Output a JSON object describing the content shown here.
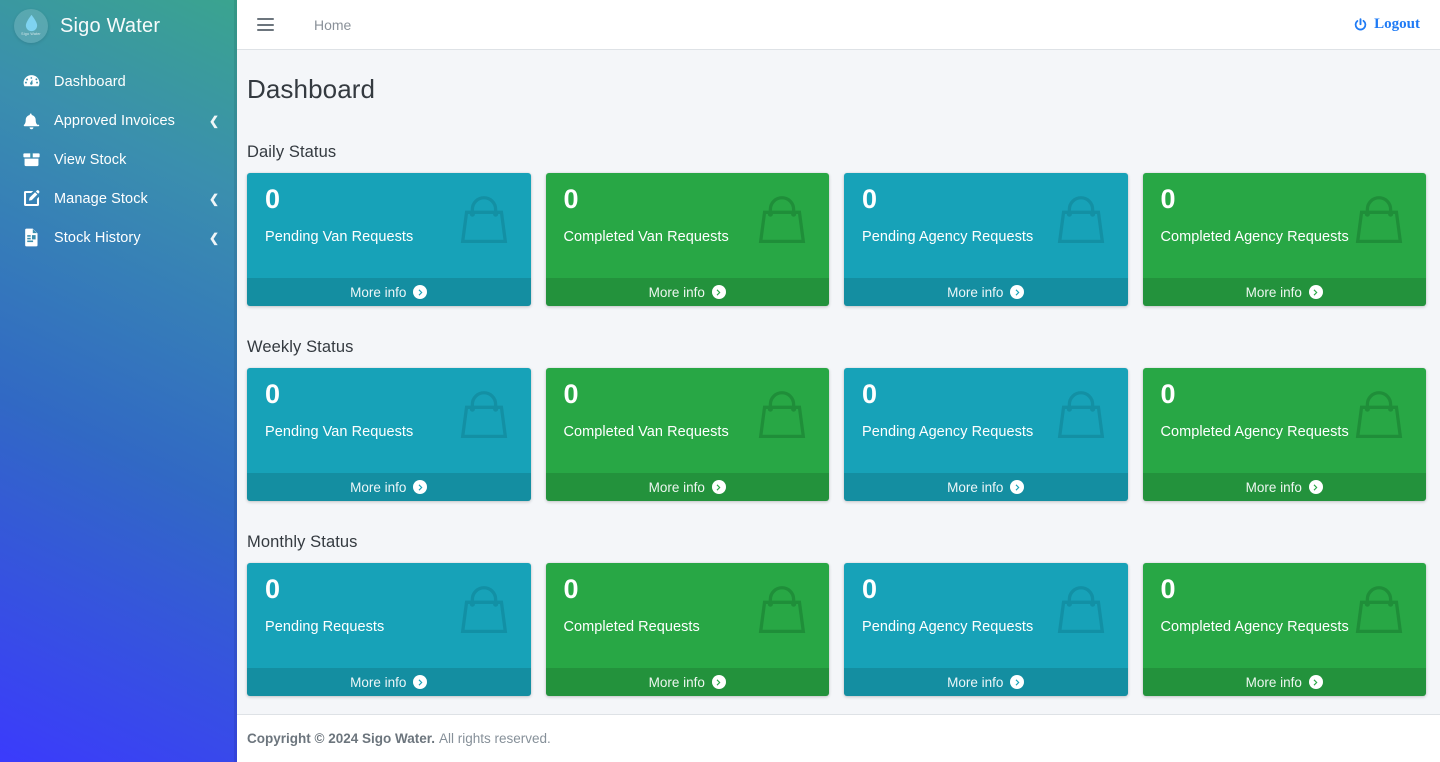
{
  "sidebar": {
    "brand": {
      "title": "Sigo Water",
      "logo_icon": "water-drop-icon",
      "logo_caption": "Sigo Water"
    },
    "items": [
      {
        "label": "Dashboard",
        "icon": "tachometer-icon",
        "chevron": ""
      },
      {
        "label": "Approved Invoices",
        "icon": "bell-icon",
        "chevron": "❮"
      },
      {
        "label": "View Stock",
        "icon": "box-icon",
        "chevron": ""
      },
      {
        "label": "Manage Stock",
        "icon": "edit-square-icon",
        "chevron": "❮"
      },
      {
        "label": "Stock History",
        "icon": "file-text-icon",
        "chevron": "❮"
      }
    ],
    "gradient_from": "#3aa48f",
    "gradient_to": "#3b3bfc"
  },
  "navbar": {
    "menu_toggle_icon": "hamburger-icon",
    "home_label": "Home",
    "logout_label": "Logout",
    "logout_icon": "power-icon",
    "logout_color": "#1f7bf5"
  },
  "page": {
    "title": "Dashboard"
  },
  "colors": {
    "teal": "#17a2b8",
    "green": "#28a745",
    "content_bg": "#f4f6f9"
  },
  "sections": [
    {
      "title": "Daily Status",
      "cards": [
        {
          "value": "0",
          "label": "Pending Van Requests",
          "color": "teal",
          "more_info": "More info",
          "icon": "shopping-bag-icon"
        },
        {
          "value": "0",
          "label": "Completed Van Requests",
          "color": "green",
          "more_info": "More info",
          "icon": "shopping-bag-icon"
        },
        {
          "value": "0",
          "label": "Pending Agency Requests",
          "color": "teal",
          "more_info": "More info",
          "icon": "shopping-bag-icon"
        },
        {
          "value": "0",
          "label": "Completed Agency Requests",
          "color": "green",
          "more_info": "More info",
          "icon": "shopping-bag-icon"
        }
      ]
    },
    {
      "title": "Weekly Status",
      "cards": [
        {
          "value": "0",
          "label": "Pending Van Requests",
          "color": "teal",
          "more_info": "More info",
          "icon": "shopping-bag-icon"
        },
        {
          "value": "0",
          "label": "Completed Van Requests",
          "color": "green",
          "more_info": "More info",
          "icon": "shopping-bag-icon"
        },
        {
          "value": "0",
          "label": "Pending Agency Requests",
          "color": "teal",
          "more_info": "More info",
          "icon": "shopping-bag-icon"
        },
        {
          "value": "0",
          "label": "Completed Agency Requests",
          "color": "green",
          "more_info": "More info",
          "icon": "shopping-bag-icon"
        }
      ]
    },
    {
      "title": "Monthly Status",
      "cards": [
        {
          "value": "0",
          "label": "Pending Requests",
          "color": "teal",
          "more_info": "More info",
          "icon": "shopping-bag-icon"
        },
        {
          "value": "0",
          "label": "Completed Requests",
          "color": "green",
          "more_info": "More info",
          "icon": "shopping-bag-icon"
        },
        {
          "value": "0",
          "label": "Pending Agency Requests",
          "color": "teal",
          "more_info": "More info",
          "icon": "shopping-bag-icon"
        },
        {
          "value": "0",
          "label": "Completed Agency Requests",
          "color": "green",
          "more_info": "More info",
          "icon": "shopping-bag-icon"
        }
      ]
    }
  ],
  "footer": {
    "copyright": "Copyright © 2024 Sigo Water.",
    "rights": "All rights reserved."
  }
}
